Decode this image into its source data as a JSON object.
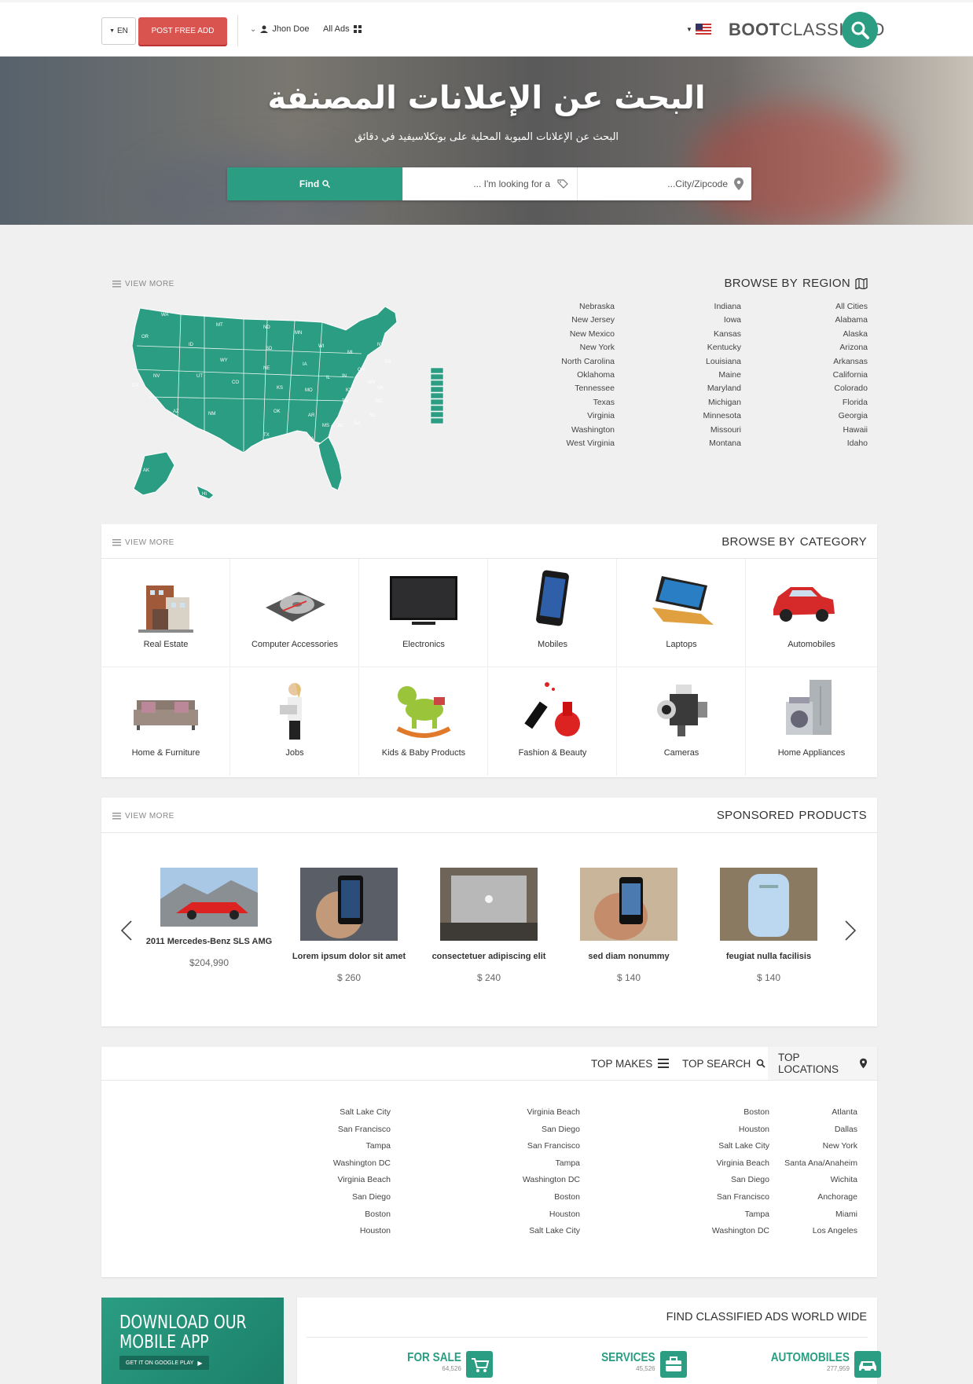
{
  "header": {
    "lang": "EN",
    "post_btn": "POST FREE ADD",
    "user": "Jhon Doe",
    "all_ads": "All Ads",
    "logo_bold": "BOOT",
    "logo_thin": "CLASSIFIED"
  },
  "hero": {
    "title": "البحث عن الإعلانات المصنفة",
    "subtitle": "البحث عن الإعلانات المبوبة المحلية على بوتكلاسيفيد في دقائق",
    "find_label": "Find",
    "looking_placeholder": "... I'm looking for a",
    "city_placeholder": "...City/Zipcode"
  },
  "region": {
    "view_more": "VIEW MORE",
    "title_thin": "BROWSE BY",
    "title_bold": "REGION",
    "col1": [
      "Nebraska",
      "New Jersey",
      "New Mexico",
      "New York",
      "North Carolina",
      "Oklahoma",
      "Tennessee",
      "Texas",
      "Virginia",
      "Washington",
      "West Virginia"
    ],
    "col2": [
      "Indiana",
      "Iowa",
      "Kansas",
      "Kentucky",
      "Louisiana",
      "Maine",
      "Maryland",
      "Michigan",
      "Minnesota",
      "Missouri",
      "Montana"
    ],
    "col3": [
      "All Cities",
      "Alabama",
      "Alaska",
      "Arizona",
      "Arkansas",
      "California",
      "Colorado",
      "Florida",
      "Georgia",
      "Hawaii",
      "Idaho"
    ],
    "map_states": [
      "WA",
      "MT",
      "ND",
      "MN",
      "OR",
      "ID",
      "SD",
      "WI",
      "MI",
      "NY",
      "WY",
      "IA",
      "NE",
      "PA",
      "OH",
      "IL",
      "IN",
      "NV",
      "UT",
      "CO",
      "KS",
      "MO",
      "KY",
      "WV",
      "VA",
      "CA",
      "TN",
      "NC",
      "AZ",
      "NM",
      "OK",
      "AR",
      "SC",
      "MS",
      "AL",
      "GA",
      "TX",
      "LA",
      "FL",
      "AK",
      "HI"
    ],
    "map_side_labels": [
      "NH",
      "VT",
      "MA",
      "RI",
      "CT",
      "NJ",
      "DE",
      "MD",
      "DC"
    ]
  },
  "category": {
    "view_more": "VIEW MORE",
    "title_thin": "BROWSE BY",
    "title_bold": "CATEGORY",
    "items": [
      {
        "label": "Real Estate",
        "icon": "building-icon"
      },
      {
        "label": "Computer Accessories",
        "icon": "hard-drive-icon"
      },
      {
        "label": "Electronics",
        "icon": "tv-icon"
      },
      {
        "label": "Mobiles",
        "icon": "phone-icon"
      },
      {
        "label": "Laptops",
        "icon": "laptop-icon"
      },
      {
        "label": "Automobiles",
        "icon": "car-icon"
      },
      {
        "label": "Home & Furniture",
        "icon": "sofa-icon"
      },
      {
        "label": "Jobs",
        "icon": "person-icon"
      },
      {
        "label": "Kids & Baby Products",
        "icon": "rocking-horse-icon"
      },
      {
        "label": "Fashion & Beauty",
        "icon": "nail-polish-icon"
      },
      {
        "label": "Cameras",
        "icon": "camera-icon"
      },
      {
        "label": "Home Appliances",
        "icon": "fridge-icon"
      }
    ]
  },
  "sponsored": {
    "view_more": "VIEW MORE",
    "title_thin": "SPONSORED",
    "title_bold": "PRODUCTS",
    "items": [
      {
        "title": "2011 Mercedes-Benz SLS AMG",
        "price": "$204,990"
      },
      {
        "title": "Lorem ipsum dolor sit amet",
        "price": "$ 260"
      },
      {
        "title": "consectetuer adipiscing elit",
        "price": "$ 240"
      },
      {
        "title": "sed diam nonummy",
        "price": "$ 140"
      },
      {
        "title": "feugiat nulla facilisis",
        "price": "$ 140"
      }
    ]
  },
  "tabs": {
    "makes": "TOP MAKES",
    "search": "TOP SEARCH",
    "locations": "TOP LOCATIONS",
    "col1": [
      "Salt Lake City",
      "San Francisco",
      "Tampa",
      "Washington DC",
      "Virginia Beach",
      "San Diego",
      "Boston",
      "Houston"
    ],
    "col2": [
      "Virginia Beach",
      "San Diego",
      "San Francisco",
      "Tampa",
      "Washington DC",
      "Boston",
      "Houston",
      "Salt Lake City"
    ],
    "col3": [
      "Boston",
      "Houston",
      "Salt Lake City",
      "Virginia Beach",
      "San Diego",
      "San Francisco",
      "Tampa",
      "Washington DC"
    ],
    "col4": [
      "Atlanta",
      "Dallas",
      "New York",
      "Santa Ana/Anaheim",
      "Wichita",
      "Anchorage",
      "Miami",
      "Los Angeles"
    ]
  },
  "app": {
    "line1": "DOWNLOAD OUR",
    "line2": "MOBILE APP",
    "google_play": "GET IT ON GOOGLE PLAY"
  },
  "worldwide": {
    "title": "FIND CLASSIFIED ADS WORLD WIDE",
    "items": [
      {
        "label": "FOR SALE",
        "count": "64,526"
      },
      {
        "label": "SERVICES",
        "count": "45,526"
      },
      {
        "label": "AUTOMOBILES",
        "count": "277,959"
      }
    ]
  },
  "colors": {
    "accent": "#2a9d82",
    "post": "#d9534f"
  }
}
